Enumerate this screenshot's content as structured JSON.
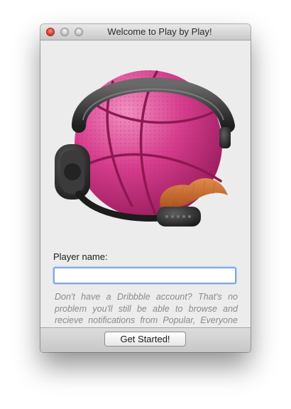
{
  "window": {
    "title": "Welcome to Play by Play!"
  },
  "form": {
    "player_label": "Player name:",
    "player_value": "",
    "help_text": "Don't have a Dribbble account? That's no problem you'll still be able to browse and recieve notifications from Popular, Everyone and Debuts."
  },
  "footer": {
    "button_label": "Get Started!"
  },
  "icons": {
    "hero": "dribbble-basketball-headset-mustache-icon"
  },
  "colors": {
    "ball": "#d63d8d",
    "mustache": "#cc6f35",
    "focus_ring": "#7fa6e0"
  }
}
